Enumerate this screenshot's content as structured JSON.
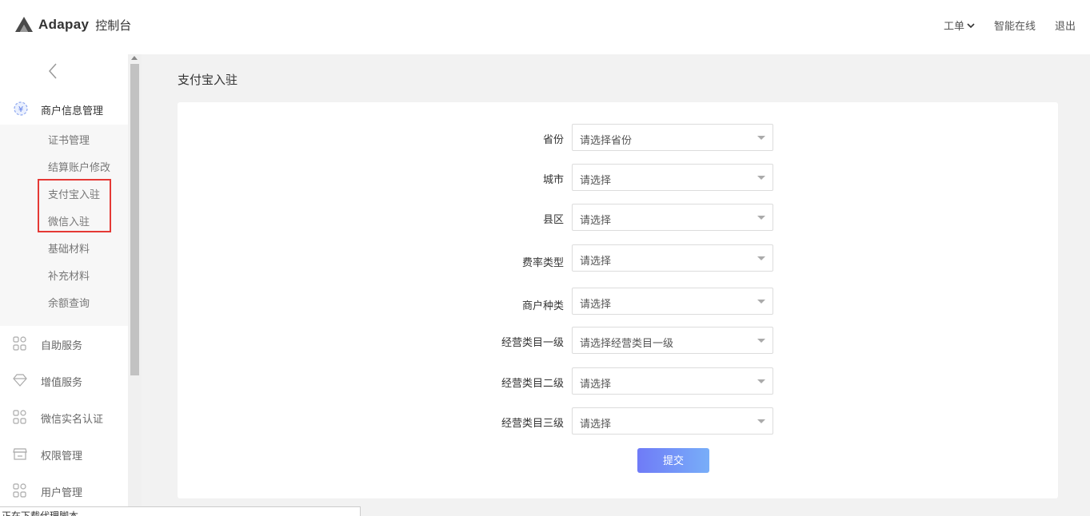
{
  "header": {
    "brand": "Adapay",
    "console": "控制台",
    "actions": {
      "ticket": "工单",
      "online": "智能在线",
      "logout": "退出"
    }
  },
  "sidebar": {
    "group": {
      "label": "商户信息管理",
      "icon": "yen-circle-icon"
    },
    "sub_items": [
      "证书管理",
      "结算账户修改",
      "支付宝入驻",
      "微信入驻",
      "基础材料",
      "补充材料",
      "余额查询"
    ],
    "nav_items": [
      {
        "label": "自助服务",
        "icon": "apps-icon"
      },
      {
        "label": "增值服务",
        "icon": "diamond-icon"
      },
      {
        "label": "微信实名认证",
        "icon": "apps-icon"
      },
      {
        "label": "权限管理",
        "icon": "store-icon"
      },
      {
        "label": "用户管理",
        "icon": "apps-icon"
      }
    ],
    "highlight_color": "#e53935"
  },
  "page": {
    "title": "支付宝入驻"
  },
  "form": {
    "fields": [
      {
        "label": "省份",
        "value": "请选择省份"
      },
      {
        "label": "城市",
        "value": "请选择"
      },
      {
        "label": "县区",
        "value": "请选择"
      },
      {
        "label": "费率类型",
        "value": "请选择"
      },
      {
        "label": "商户种类",
        "value": "请选择"
      },
      {
        "label": "经营类目一级",
        "value": "请选择经营类目一级"
      },
      {
        "label": "经营类目二级",
        "value": "请选择"
      },
      {
        "label": "经营类目三级",
        "value": "请选择"
      }
    ],
    "submit": "提交"
  },
  "statusbar": {
    "text": "正在下载代理脚本..."
  },
  "colors": {
    "accent_start": "#6f7bf7",
    "accent_end": "#78aef8",
    "background": "#f2f2f2"
  }
}
